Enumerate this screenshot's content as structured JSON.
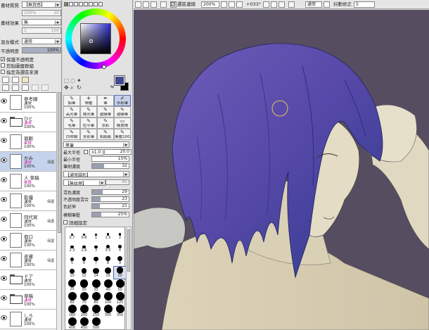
{
  "layer_props": {
    "paper_texture_label": "畫材質質",
    "paper_texture_value": "【無質感】",
    "scale_value": "100%",
    "scale_value2": "20",
    "effect_label": "畫材效果",
    "effect_value": "無",
    "width_value": "1",
    "width_value2": "100",
    "blend_label": "混合模式",
    "blend_value": "通常",
    "opacity_label": "不透明度",
    "opacity_value": "100%",
    "preserve_opacity": "保護不透明度",
    "clipping_group": "剪貼圖層群組",
    "selection_source": "指定為選區來源"
  },
  "layers": [
    {
      "name": "參考線",
      "mode": "通常",
      "opacity": "100%",
      "type": "layer",
      "pink": false,
      "selected": false,
      "badge": ""
    },
    {
      "name": "ひと",
      "mode": "通常",
      "opacity": "100%",
      "type": "folder",
      "pink": true,
      "selected": false,
      "badge": ""
    },
    {
      "name": "眉眼",
      "mode": "乘算",
      "opacity": "100%",
      "type": "layer",
      "pink": true,
      "selected": false,
      "badge": ""
    },
    {
      "name": "かみ",
      "mode": "通常",
      "opacity": "100%",
      "type": "layer",
      "pink": true,
      "selected": true,
      "badge": "保護"
    },
    {
      "name": "人 草稿",
      "mode": "乘算",
      "opacity": "100%",
      "type": "layer",
      "pink": true,
      "selected": false,
      "badge": ""
    },
    {
      "name": "影撮",
      "mode": "通常",
      "opacity": "100%",
      "type": "layer",
      "pink": false,
      "selected": false,
      "badge": "保護"
    },
    {
      "name": "同代寫",
      "mode": "通常",
      "opacity": "100%",
      "type": "layer",
      "pink": false,
      "selected": false,
      "badge": "保護"
    },
    {
      "name": "假口",
      "mode": "通常",
      "opacity": "100%",
      "type": "layer",
      "pink": false,
      "selected": false,
      "badge": "保護"
    },
    {
      "name": "皮膚",
      "mode": "通常",
      "opacity": "100%",
      "type": "layer",
      "pink": false,
      "selected": false,
      "badge": "保護"
    },
    {
      "name": "ドア",
      "mode": "通常",
      "opacity": "100%",
      "type": "folder",
      "pink": false,
      "selected": false,
      "badge": ""
    },
    {
      "name": "草稿",
      "mode": "通常",
      "opacity": "100%",
      "type": "folder",
      "pink": true,
      "selected": false,
      "badge": ""
    },
    {
      "name": "しろ",
      "mode": "通常",
      "opacity": "100%",
      "type": "layer",
      "pink": false,
      "selected": false,
      "badge": ""
    }
  ],
  "color": {
    "foreground": "#414a8e",
    "background": "#000000"
  },
  "tools": [
    {
      "label": "鉛筆",
      "icon": "✎",
      "selected": false
    },
    {
      "label": "噴槍",
      "icon": "✈",
      "selected": false
    },
    {
      "label": "筆",
      "icon": "✒",
      "selected": false
    },
    {
      "label": "水彩筆",
      "icon": "✐",
      "selected": true
    },
    {
      "label": "高光筆",
      "icon": "✎",
      "selected": false
    },
    {
      "label": "綠光筆",
      "icon": "✎",
      "selected": false
    },
    {
      "label": "邊緣筆",
      "icon": "✎",
      "selected": false
    },
    {
      "label": "邊緣筆",
      "icon": "✎",
      "selected": false
    },
    {
      "label": "毛筆",
      "icon": "✎",
      "selected": false
    },
    {
      "label": "拉平筆",
      "icon": "✎",
      "selected": false
    },
    {
      "label": "水彩",
      "icon": "✎",
      "selected": false
    },
    {
      "label": "橡皮擦",
      "icon": "▭",
      "selected": false
    },
    {
      "label": "白帶線",
      "icon": "✎",
      "selected": false
    },
    {
      "label": "水彩筆",
      "icon": "✎",
      "selected": false
    },
    {
      "label": "和紙紙",
      "icon": "✎",
      "selected": false
    },
    {
      "label": "筆壓100",
      "icon": "✎",
      "selected": false
    }
  ],
  "brush": {
    "shape_value": "黑筆",
    "max_radius_label": "最大半徑",
    "max_radius_mult": "x1.0",
    "max_radius_value": "20.0",
    "min_radius_label": "最小半徑",
    "min_radius_value": "15%",
    "density_label": "筆刷濃度",
    "density_value": "32",
    "density_fraction": 0.32,
    "shape_dd": "【通常圓形】",
    "texture_dd": "【無紋理】",
    "texture_value": "95",
    "mix_label": "混色濃度",
    "mix_value": "29",
    "mix_fraction": 0.29,
    "opacity_mix_label": "不透明度混合",
    "opacity_mix_value": "23",
    "opacity_mix_fraction": 0.23,
    "persist_label": "色延伸",
    "persist_value": "21",
    "persist_fraction": 0.21,
    "blur_label": "模糊筆壓",
    "blur_value": "25%",
    "blur_fraction": 0.25,
    "detail_label": "詳細設定"
  },
  "brush_sizes": [
    [
      "0.7",
      "0.8",
      "1",
      "1.5",
      "2"
    ],
    [
      "2.3",
      "2.6",
      "3",
      "3.5",
      "4"
    ],
    [
      "5",
      "6",
      "7",
      "8",
      "9"
    ],
    [
      "10",
      "12",
      "14",
      "16",
      "20"
    ],
    [
      "25",
      "30",
      "35",
      "40",
      "50"
    ],
    [
      "60",
      "70",
      "80",
      "100",
      "120"
    ],
    [
      "160",
      "200",
      "250",
      "300",
      "350"
    ],
    [
      "400",
      "450",
      "500"
    ]
  ],
  "brush_sizes_selected": "20",
  "toolbar": {
    "antialias_label": "選區邊緣",
    "zoom_value": "200%",
    "angle_value": "+033°",
    "blend_value": "通常",
    "stabilizer_label": "抖動修正",
    "stabilizer_value": "5"
  }
}
